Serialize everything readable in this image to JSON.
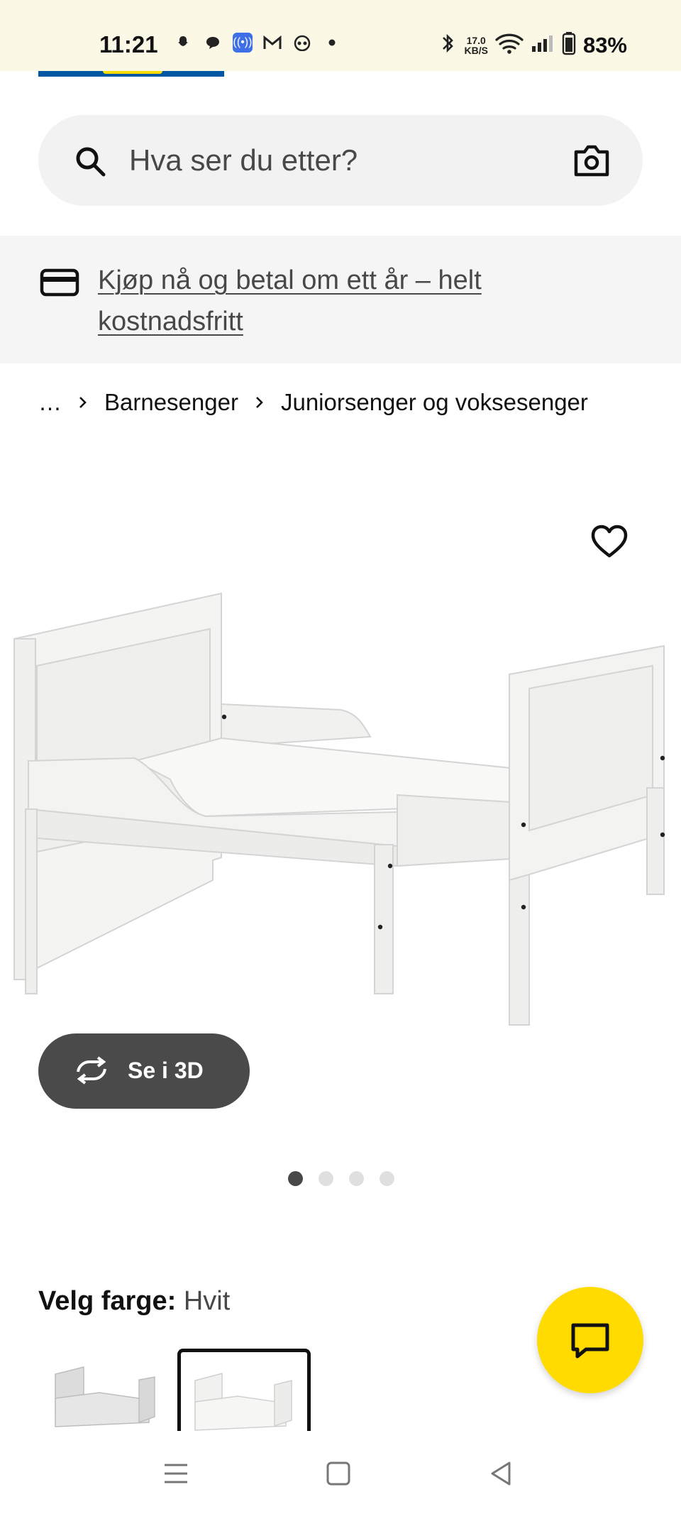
{
  "status_bar": {
    "time": "11:21",
    "net_speed_value": "17.0",
    "net_speed_unit": "KB/S",
    "battery": "83%",
    "left_icons": [
      "snapchat-icon",
      "chat-bubble-icon",
      "hotspot-icon",
      "gmail-icon",
      "app-icon",
      "dot-icon"
    ],
    "right_icons": [
      "bluetooth-icon",
      "wifi-icon",
      "signal-icon",
      "battery-icon"
    ]
  },
  "search": {
    "placeholder": "Hva ser du etter?"
  },
  "promo": {
    "text": "Kjøp nå og betal om ett år – helt kostnadsfritt"
  },
  "breadcrumb": {
    "items": [
      "…",
      "Barnesenger",
      "Juniorsenger og voksesenger"
    ]
  },
  "product": {
    "view_3d_label": "Se i 3D",
    "carousel": {
      "count": 4,
      "active_index": 0
    }
  },
  "color_picker": {
    "label": "Velg farge:",
    "selected": "Hvit"
  },
  "colors": {
    "brand_blue": "#0058a3",
    "brand_yellow": "#ffdb00",
    "button_dark": "#4a4a4a"
  }
}
